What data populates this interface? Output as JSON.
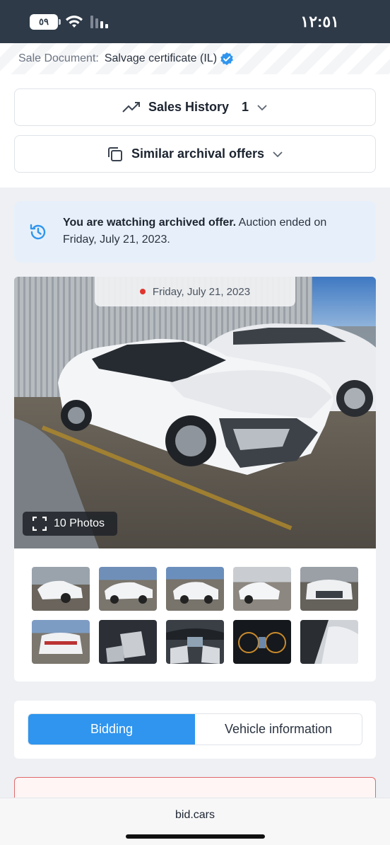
{
  "status": {
    "battery": "٥٩",
    "time": "١٢:٥١"
  },
  "sale_document": {
    "label": "Sale Document:",
    "value": "Salvage certificate (IL)"
  },
  "sales_history": {
    "label": "Sales History",
    "count": "1"
  },
  "similar": {
    "label": "Similar archival offers"
  },
  "notice": {
    "bold": "You are watching archived offer.",
    "rest": " Auction ended on Friday, July 21, 2023."
  },
  "gallery": {
    "date": "Friday, July 21, 2023",
    "photos_label": "10 Photos"
  },
  "thumbnails": [
    {
      "label": "photo 1"
    },
    {
      "label": "photo 2"
    },
    {
      "label": "photo 3"
    },
    {
      "label": "photo 4"
    },
    {
      "label": "photo 5"
    },
    {
      "label": "photo 6"
    },
    {
      "label": "photo 7"
    },
    {
      "label": "photo 8"
    },
    {
      "label": "photo 9"
    },
    {
      "label": "photo 10"
    }
  ],
  "tabs": {
    "bidding": "Bidding",
    "vehicle": "Vehicle information"
  },
  "browser": {
    "url": "bid.cars"
  },
  "colors": {
    "accent": "#2f95ee",
    "status_bar": "#2e3a48",
    "notice_bg": "#e7f0fa",
    "live_dot": "#e0342f"
  }
}
